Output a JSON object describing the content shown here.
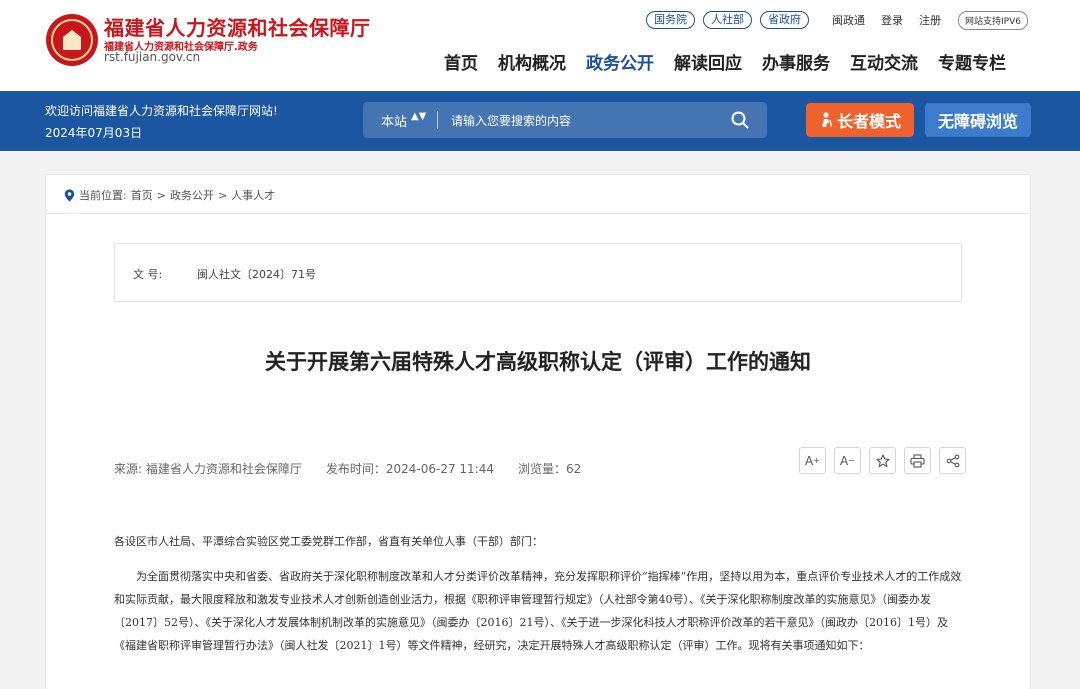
{
  "header": {
    "site_title": "福建省人力资源和社会保障厅",
    "site_subtitle": "福建省人力资源和社会保障厅.政务",
    "site_url": "rst.fujian.gov.cn",
    "gov_links": [
      "国务院",
      "人社部",
      "省政府"
    ],
    "user_links": [
      "闽政通",
      "登录",
      "注册"
    ],
    "ipv6_label": "网站支持IPV6",
    "nav": [
      "首页",
      "机构概况",
      "政务公开",
      "解读回应",
      "办事服务",
      "互动交流",
      "专题专栏"
    ],
    "nav_active_index": 2
  },
  "bluebar": {
    "welcome": "欢迎访问福建省人力资源和社会保障厅网站!",
    "date": "2024年07月03日",
    "search_scope": "本站",
    "search_placeholder": "请输入您要搜索的内容",
    "elder_mode_label": "长者模式",
    "accessible_label": "无障碍浏览"
  },
  "breadcrumb": {
    "prefix": "当前位置:",
    "items": [
      "首页",
      "政务公开",
      "人事人才"
    ],
    "separator": ">"
  },
  "document": {
    "number_label": "文 号:",
    "number_value": "闽人社文〔2024〕71号",
    "title": "关于开展第六届特殊人才高级职称认定（评审）工作的通知",
    "source": "来源: 福建省人力资源和社会保障厅",
    "published": "发布时间：2024-06-27 11:44",
    "views": "浏览量：62",
    "tools": {
      "font_up": "A",
      "font_down": "A",
      "font_up_mark": "+",
      "font_down_mark": "−"
    },
    "paragraphs": [
      "各设区市人社局、平潭综合实验区党工委党群工作部，省直有关单位人事（干部）部门：",
      "为全面贯彻落实中央和省委、省政府关于深化职称制度改革和人才分类评价改革精神，充分发挥职称评价“指挥棒”作用，坚持以用为本，重点评价专业技术人才的工作成效和实际贡献，最大限度释放和激发专业技术人才创新创造创业活力，根据《职称评审管理暂行规定》（人社部令第40号）、《关于深化职称制度改革的实施意见》（闽委办发〔2017〕52号）、《关于深化人才发展体制机制改革的实施意见》（闽委办〔2016〕21号）、《关于进一步深化科技人才职称评价改革的若干意见》（闽政办〔2016〕1号）及《福建省职称评审管理暂行办法》（闽人社发〔2021〕1号）等文件精神，经研究，决定开展特殊人才高级职称认定（评审）工作。现将有关事项通知如下："
    ]
  },
  "colors": {
    "brand_red": "#c8161d",
    "brand_blue": "#1b56a2",
    "elder_orange": "#f0622d",
    "accessible_blue": "#3d7ccb"
  }
}
